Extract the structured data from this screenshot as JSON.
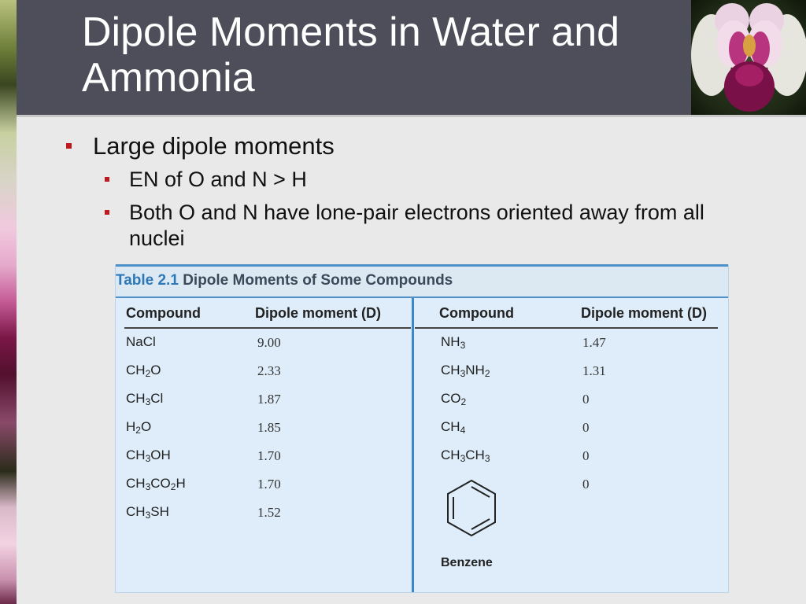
{
  "slide": {
    "title": "Dipole Moments in Water and Ammonia",
    "bullets": [
      {
        "level": 1,
        "text": "Large dipole moments"
      },
      {
        "level": 2,
        "text": "EN of  O and N > H"
      },
      {
        "level": 2,
        "text": "Both O and N have lone-pair electrons oriented away from all nuclei"
      }
    ]
  },
  "table": {
    "caption_number": "Table 2.1",
    "caption_text": "Dipole Moments of Some Compounds",
    "headers": {
      "left_compound": "Compound",
      "left_value": "Dipole moment (D)",
      "right_compound": "Compound",
      "right_value": "Dipole moment (D)"
    },
    "left_rows": [
      {
        "formula": "NaCl",
        "value": "9.00"
      },
      {
        "formula": "CH2O",
        "value": "2.33"
      },
      {
        "formula": "CH3Cl",
        "value": "1.87"
      },
      {
        "formula": "H2O",
        "value": "1.85"
      },
      {
        "formula": "CH3OH",
        "value": "1.70"
      },
      {
        "formula": "CH3CO2H",
        "value": "1.70"
      },
      {
        "formula": "CH3SH",
        "value": "1.52"
      }
    ],
    "right_rows": [
      {
        "formula": "NH3",
        "value": "1.47"
      },
      {
        "formula": "CH3NH2",
        "value": "1.31"
      },
      {
        "formula": "CO2",
        "value": "0"
      },
      {
        "formula": "CH4",
        "value": "0"
      },
      {
        "formula": "CH3CH3",
        "value": "0"
      },
      {
        "formula": "",
        "value": "0"
      }
    ],
    "benzene_label": "Benzene"
  },
  "colors": {
    "title_bar": "#4e4e5a",
    "bullet": "#c0181e",
    "table_bg": "#deedf9",
    "table_accent": "#3a88c8"
  }
}
